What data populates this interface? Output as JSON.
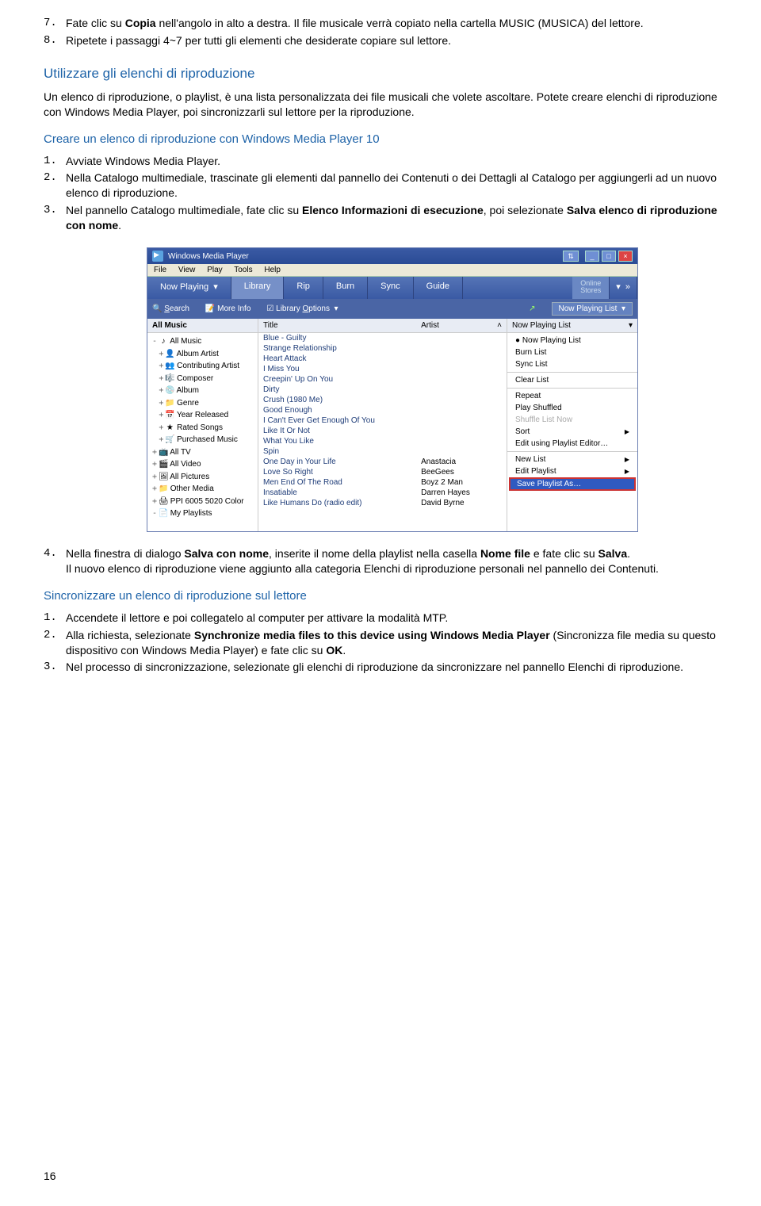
{
  "steps_a": [
    {
      "n": "7.",
      "pre": "Fate clic su ",
      "bold": "Copia",
      "post": " nell'angolo in alto a destra. Il file musicale verrà copiato nella cartella MUSIC (MUSICA) del lettore."
    },
    {
      "n": "8.",
      "pre": "Ripetete i passaggi 4~7 per tutti gli elementi che desiderate copiare sul lettore.",
      "bold": "",
      "post": ""
    }
  ],
  "h1": "Utilizzare gli elenchi di riproduzione",
  "p1": "Un elenco di riproduzione, o playlist, è una lista personalizzata dei file musicali che volete ascoltare. Potete creare elenchi di riproduzione con Windows Media Player, poi sincronizzarli sul lettore per la riproduzione.",
  "h2": "Creare un elenco di riproduzione con Windows Media Player 10",
  "steps_b": {
    "1": {
      "n": "1.",
      "text": "Avviate Windows Media Player."
    },
    "2": {
      "n": "2.",
      "text": "Nella Catalogo multimediale, trascinate gli elementi dal pannello dei Contenuti o dei Dettagli al Catalogo per aggiungerli ad un nuovo elenco di riproduzione."
    },
    "3": {
      "n": "3.",
      "pre": "Nel pannello Catalogo multimediale, fate clic su ",
      "b1": "Elenco Informazioni di esecuzione",
      "mid": ", poi selezionate ",
      "b2": "Salva elenco di riproduzione con nome",
      "post": "."
    }
  },
  "wmp": {
    "title": "Windows Media Player",
    "menus": [
      "File",
      "View",
      "Play",
      "Tools",
      "Help"
    ],
    "tabs": [
      "Now Playing",
      "Library",
      "Rip",
      "Burn",
      "Sync",
      "Guide"
    ],
    "online": "Online\nStores",
    "toolbar": {
      "search": "Search",
      "moreinfo": "More Info",
      "libopts": "Library Options",
      "nowplaying": "Now Playing List"
    },
    "leftHeader": "All Music",
    "tree": [
      {
        "pm": "-",
        "ic": "♪",
        "t": "All Music"
      },
      {
        "pm": "+",
        "ic": "👤",
        "t": "Album Artist",
        "ind": 1
      },
      {
        "pm": "+",
        "ic": "👥",
        "t": "Contributing Artist",
        "ind": 1
      },
      {
        "pm": "+",
        "ic": "🎼",
        "t": "Composer",
        "ind": 1
      },
      {
        "pm": "+",
        "ic": "💿",
        "t": "Album",
        "ind": 1
      },
      {
        "pm": "+",
        "ic": "📁",
        "t": "Genre",
        "ind": 1
      },
      {
        "pm": "+",
        "ic": "📅",
        "t": "Year Released",
        "ind": 1
      },
      {
        "pm": "+",
        "ic": "★",
        "t": "Rated Songs",
        "ind": 1
      },
      {
        "pm": "+",
        "ic": "🛒",
        "t": "Purchased Music",
        "ind": 1
      },
      {
        "pm": "+",
        "ic": "📺",
        "t": "All TV"
      },
      {
        "pm": "+",
        "ic": "🎬",
        "t": "All Video"
      },
      {
        "pm": "+",
        "ic": "🖼",
        "t": "All Pictures"
      },
      {
        "pm": "+",
        "ic": "📁",
        "t": "Other Media"
      },
      {
        "pm": "+",
        "ic": "🖨",
        "t": "PPI 6005 5020 Color"
      },
      {
        "pm": "-",
        "ic": "📄",
        "t": "My Playlists"
      }
    ],
    "cols": [
      "Title",
      "Artist"
    ],
    "songs": [
      [
        "Blue - Guilty",
        ""
      ],
      [
        "Strange Relationship",
        ""
      ],
      [
        "Heart Attack",
        ""
      ],
      [
        "I Miss You",
        ""
      ],
      [
        "Creepin' Up On You",
        ""
      ],
      [
        "Dirty",
        ""
      ],
      [
        "Crush (1980 Me)",
        ""
      ],
      [
        "Good Enough",
        ""
      ],
      [
        "I Can't Ever Get Enough Of You",
        ""
      ],
      [
        "Like It Or Not",
        ""
      ],
      [
        "What You Like",
        ""
      ],
      [
        "Spin",
        ""
      ],
      [
        "One Day in Your Life",
        "Anastacia"
      ],
      [
        "Love So Right",
        "BeeGees"
      ],
      [
        "Men End Of The Road",
        "Boyz 2 Man"
      ],
      [
        "Insatiable",
        "Darren Hayes"
      ],
      [
        "Like Humans Do (radio edit)",
        "David Byrne"
      ]
    ],
    "rightMenu": [
      {
        "t": "Now Playing List",
        "dot": true
      },
      {
        "t": "Burn List"
      },
      {
        "t": "Sync List"
      },
      {
        "sep": true
      },
      {
        "t": "Clear List"
      },
      {
        "sep": true
      },
      {
        "t": "Repeat"
      },
      {
        "t": "Play Shuffled"
      },
      {
        "t": "Shuffle List Now",
        "dis": true
      },
      {
        "t": "Sort",
        "arr": true
      },
      {
        "t": "Edit using Playlist Editor…"
      },
      {
        "sep": true
      },
      {
        "t": "New List",
        "arr": true
      },
      {
        "t": "Edit Playlist",
        "arr": true
      },
      {
        "t": "Save Playlist As…",
        "sel": true
      }
    ]
  },
  "steps_c": {
    "4": {
      "n": "4.",
      "pre": "Nella finestra di dialogo ",
      "b1": "Salva con nome",
      "mid": ", inserite il nome della playlist nella casella ",
      "b2": "Nome file",
      "mid2": " e fate clic su ",
      "b3": "Salva",
      "post": ".",
      "line2": "Il nuovo elenco di riproduzione viene aggiunto alla categoria Elenchi di riproduzione personali nel pannello dei Contenuti."
    }
  },
  "h3": "Sincronizzare un elenco di riproduzione sul lettore",
  "steps_d": {
    "1": {
      "n": "1.",
      "text": "Accendete il lettore e poi collegatelo al computer per attivare la modalità MTP."
    },
    "2": {
      "n": "2.",
      "pre": "Alla richiesta, selezionate ",
      "b1": "Synchronize media files to this device using Windows Media Player",
      "mid": " (Sincronizza file media su questo dispositivo con Windows Media Player) e fate clic su ",
      "b2": "OK",
      "post": "."
    },
    "3": {
      "n": "3.",
      "text": "Nel processo di sincronizzazione, selezionate gli elenchi di riproduzione da sincronizzare nel pannello Elenchi di riproduzione."
    }
  },
  "pageNum": "16"
}
